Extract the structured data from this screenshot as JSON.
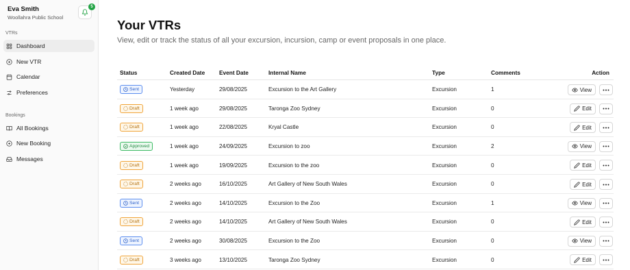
{
  "user": {
    "name": "Eva Smith",
    "school": "Woollahra Public School",
    "notification_count": "5"
  },
  "sidebar": {
    "vtrs_label": "VTRs",
    "vtrs_items": [
      {
        "label": "Dashboard",
        "icon": "grid-icon",
        "active": true
      },
      {
        "label": "New VTR",
        "icon": "plus-circle-icon"
      },
      {
        "label": "Calendar",
        "icon": "calendar-icon"
      },
      {
        "label": "Preferences",
        "icon": "sliders-icon"
      }
    ],
    "bookings_label": "Bookings",
    "bookings_items": [
      {
        "label": "All Bookings",
        "icon": "book-icon"
      },
      {
        "label": "New Booking",
        "icon": "plus-circle-icon"
      },
      {
        "label": "Messages",
        "icon": "inbox-icon"
      }
    ]
  },
  "page": {
    "title": "Your VTRs",
    "subtitle": "View, edit or track the status of all your excursion, incursion, camp or event proposals in one place."
  },
  "table": {
    "headers": [
      "Status",
      "Created Date",
      "Event Date",
      "Internal Name",
      "Type",
      "Comments",
      "Action"
    ],
    "rows": [
      {
        "status": "Sent",
        "created": "Yesterday",
        "event": "29/08/2025",
        "name": "Excursion to the Art Gallery",
        "type": "Excursion",
        "comments": "1",
        "action": "View"
      },
      {
        "status": "Draft",
        "created": "1 week ago",
        "event": "29/08/2025",
        "name": "Taronga Zoo Sydney",
        "type": "Excursion",
        "comments": "0",
        "action": "Edit"
      },
      {
        "status": "Draft",
        "created": "1 week ago",
        "event": "22/08/2025",
        "name": "Kryal Castle",
        "type": "Excursion",
        "comments": "0",
        "action": "Edit"
      },
      {
        "status": "Approved",
        "created": "1 week ago",
        "event": "24/09/2025",
        "name": "Excursion to zoo",
        "type": "Excursion",
        "comments": "2",
        "action": "View"
      },
      {
        "status": "Draft",
        "created": "1 week ago",
        "event": "19/09/2025",
        "name": "Excursion to the zoo",
        "type": "Excursion",
        "comments": "0",
        "action": "Edit"
      },
      {
        "status": "Draft",
        "created": "2 weeks ago",
        "event": "16/10/2025",
        "name": "Art Gallery of New South Wales",
        "type": "Excursion",
        "comments": "0",
        "action": "Edit"
      },
      {
        "status": "Sent",
        "created": "2 weeks ago",
        "event": "14/10/2025",
        "name": "Excursion to the Zoo",
        "type": "Excursion",
        "comments": "1",
        "action": "View"
      },
      {
        "status": "Draft",
        "created": "2 weeks ago",
        "event": "14/10/2025",
        "name": "Art Gallery of New South Wales",
        "type": "Excursion",
        "comments": "0",
        "action": "Edit"
      },
      {
        "status": "Sent",
        "created": "2 weeks ago",
        "event": "30/08/2025",
        "name": "Excursion to the Zoo",
        "type": "Excursion",
        "comments": "0",
        "action": "View"
      },
      {
        "status": "Draft",
        "created": "3 weeks ago",
        "event": "13/10/2025",
        "name": "Taronga Zoo Sydney",
        "type": "Excursion",
        "comments": "0",
        "action": "Edit"
      }
    ]
  },
  "colors": {
    "sent": "#2f62c9",
    "draft": "#b4700e",
    "approved": "#1f8a40",
    "notification": "#22a344"
  }
}
